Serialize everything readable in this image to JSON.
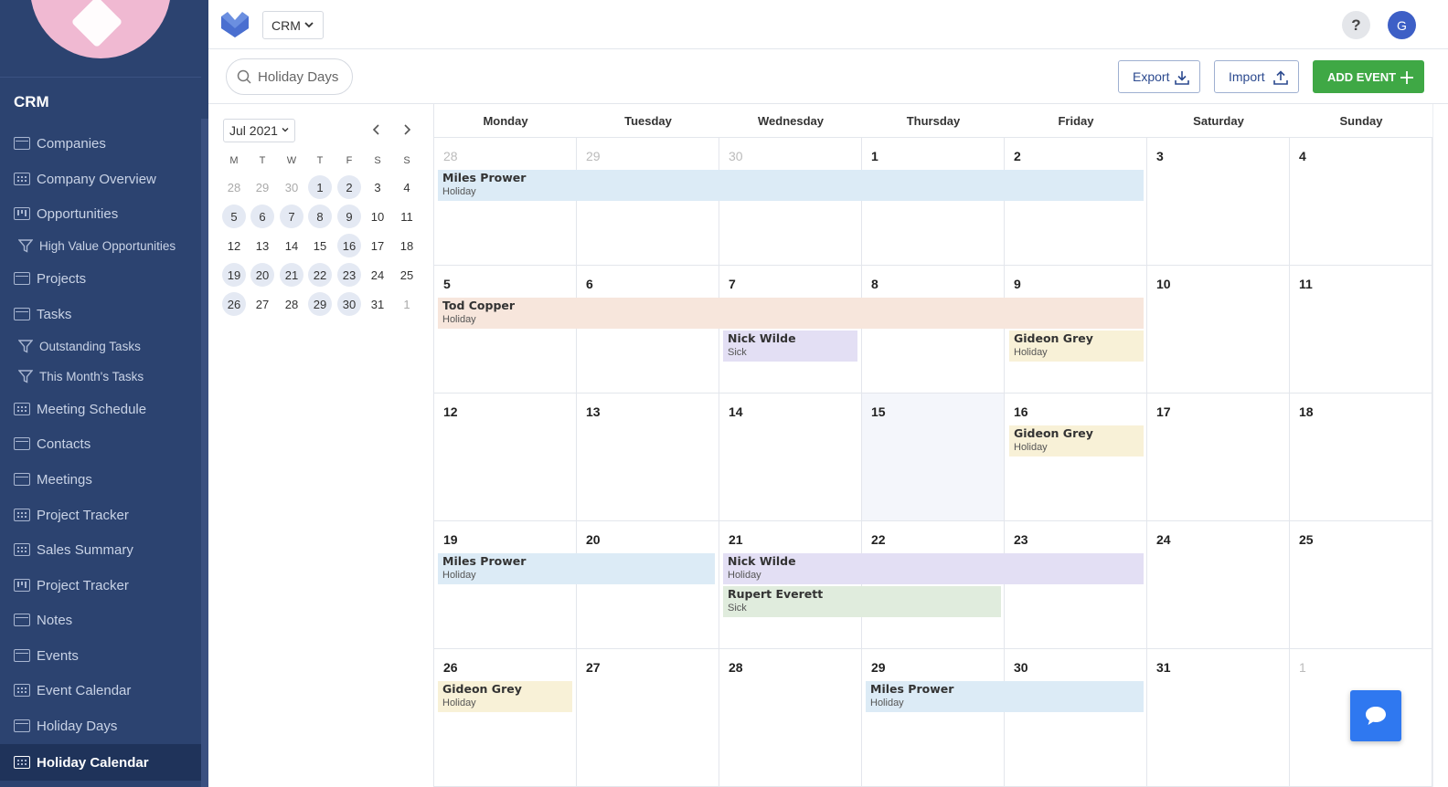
{
  "sidebar": {
    "section_title": "CRM",
    "items": [
      {
        "label": "Companies",
        "icon": "list-icon"
      },
      {
        "label": "Company Overview",
        "icon": "grid-icon"
      },
      {
        "label": "Opportunities",
        "icon": "kanban-icon"
      },
      {
        "label": "High Value Opportunities",
        "icon": "filter-icon"
      },
      {
        "label": "Projects",
        "icon": "list-icon"
      },
      {
        "label": "Tasks",
        "icon": "list-icon"
      },
      {
        "label": "Outstanding Tasks",
        "icon": "filter-icon"
      },
      {
        "label": "This Month's Tasks",
        "icon": "filter-icon"
      },
      {
        "label": "Meeting Schedule",
        "icon": "grid-icon"
      },
      {
        "label": "Contacts",
        "icon": "list-icon"
      },
      {
        "label": "Meetings",
        "icon": "list-icon"
      },
      {
        "label": "Project Tracker",
        "icon": "grid-icon"
      },
      {
        "label": "Sales Summary",
        "icon": "grid-icon"
      },
      {
        "label": "Project Tracker",
        "icon": "kanban-icon"
      },
      {
        "label": "Notes",
        "icon": "list-icon"
      },
      {
        "label": "Events",
        "icon": "list-icon"
      },
      {
        "label": "Event Calendar",
        "icon": "grid-icon"
      },
      {
        "label": "Holiday Days",
        "icon": "list-icon"
      },
      {
        "label": "Holiday Calendar",
        "icon": "grid-icon"
      }
    ]
  },
  "topbar": {
    "app_select": "CRM",
    "help": "?",
    "avatar": "G"
  },
  "toolbar": {
    "search_value": "Holiday Days",
    "export_label": "Export",
    "import_label": "Import",
    "add_label": "ADD EVENT"
  },
  "mini_calendar": {
    "month_label": "Jul 2021",
    "weekdays": [
      "M",
      "T",
      "W",
      "T",
      "F",
      "S",
      "S"
    ],
    "weeks": [
      [
        "28",
        "29",
        "30",
        "1",
        "2",
        "3",
        "4"
      ],
      [
        "5",
        "6",
        "7",
        "8",
        "9",
        "10",
        "11"
      ],
      [
        "12",
        "13",
        "14",
        "15",
        "16",
        "17",
        "18"
      ],
      [
        "19",
        "20",
        "21",
        "22",
        "23",
        "24",
        "25"
      ],
      [
        "26",
        "27",
        "28",
        "29",
        "30",
        "31",
        "1"
      ]
    ]
  },
  "calendar": {
    "weekdays": [
      "Monday",
      "Tuesday",
      "Wednesday",
      "Thursday",
      "Friday",
      "Saturday",
      "Sunday"
    ],
    "weeks": [
      [
        "28",
        "29",
        "30",
        "1",
        "2",
        "3",
        "4"
      ],
      [
        "5",
        "6",
        "7",
        "8",
        "9",
        "10",
        "11"
      ],
      [
        "12",
        "13",
        "14",
        "15",
        "16",
        "17",
        "18"
      ],
      [
        "19",
        "20",
        "21",
        "22",
        "23",
        "24",
        "25"
      ],
      [
        "26",
        "27",
        "28",
        "29",
        "30",
        "31",
        "1"
      ]
    ],
    "events": [
      {
        "name": "Miles Prower",
        "type": "Holiday",
        "color": "#dcebf6"
      },
      {
        "name": "Tod Copper",
        "type": "Holiday",
        "color": "#f7e6dc"
      },
      {
        "name": "Nick Wilde",
        "type": "Sick",
        "color": "#e3dff4"
      },
      {
        "name": "Gideon Grey",
        "type": "Holiday",
        "color": "#f8f1d7"
      },
      {
        "name": "Gideon Grey",
        "type": "Holiday",
        "color": "#f8f1d7"
      },
      {
        "name": "Miles Prower",
        "type": "Holiday",
        "color": "#dcebf6"
      },
      {
        "name": "Nick Wilde",
        "type": "Holiday",
        "color": "#e3dff4"
      },
      {
        "name": "Rupert Everett",
        "type": "Sick",
        "color": "#e0ecdd"
      },
      {
        "name": "Gideon Grey",
        "type": "Holiday",
        "color": "#f8f1d7"
      },
      {
        "name": "Miles Prower",
        "type": "Holiday",
        "color": "#dcebf6"
      }
    ]
  },
  "colors": {
    "sidebar_bg": "#2c4370",
    "accent_green": "#3fa845",
    "avatar_blue": "#3d5fc6",
    "chat_blue": "#2f78f0"
  }
}
